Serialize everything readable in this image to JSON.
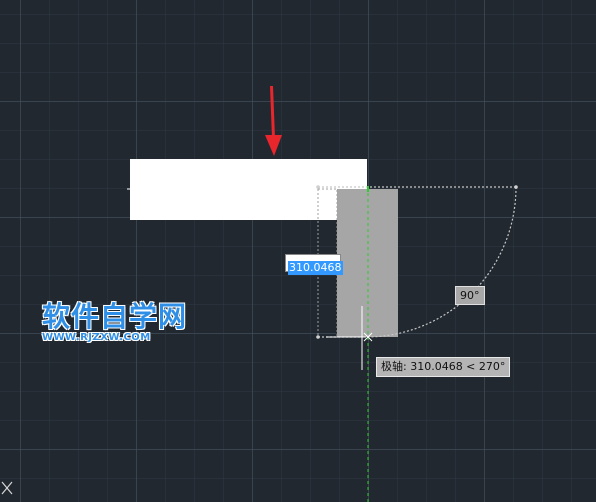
{
  "drawing": {
    "dynamic_input_value": "310.0468",
    "angle_tooltip": "90°",
    "polar_tracking_tooltip": "极轴: 310.0468 < 270°"
  },
  "watermark": {
    "title": "软件自学网",
    "url": "WWW.RJZXW.COM"
  },
  "colors": {
    "background": "#212830",
    "annotation_arrow": "#e8262c",
    "tracking_line": "#2ecc2e",
    "selection_preview": "#a6a6a6"
  },
  "icons": {
    "annotation": "red-down-arrow-icon",
    "cursor": "crosshair-cursor-icon",
    "ucs": "ucs-corner-icon"
  }
}
